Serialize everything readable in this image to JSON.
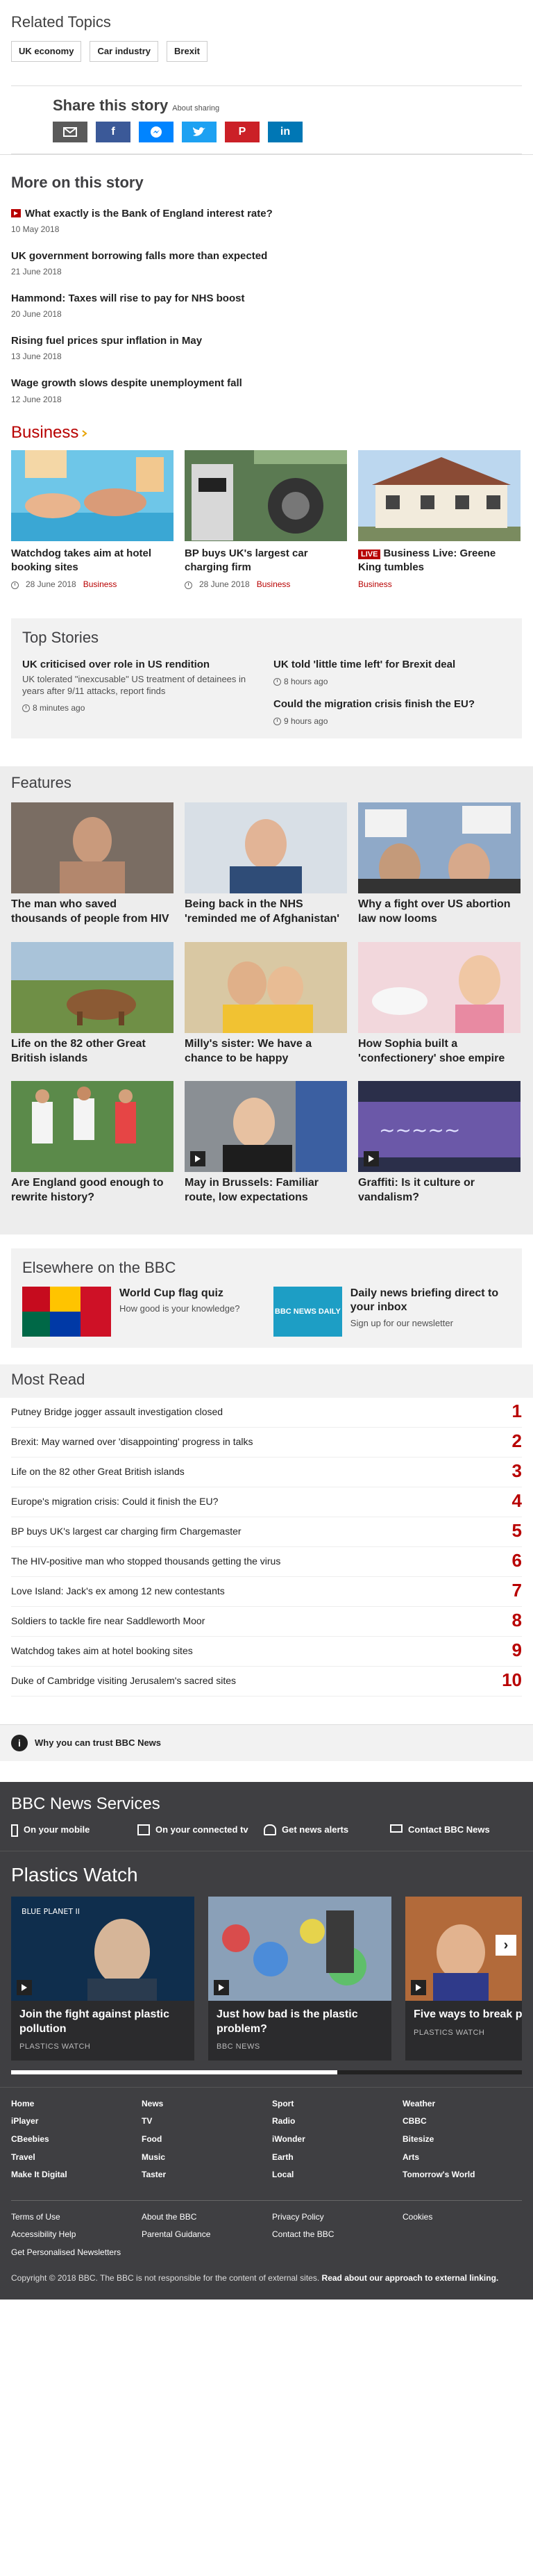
{
  "related": {
    "title": "Related Topics",
    "tags": [
      "UK economy",
      "Car industry",
      "Brexit"
    ]
  },
  "share": {
    "title": "Share this story",
    "about": "About sharing",
    "buttons": [
      "email-icon",
      "facebook-icon",
      "messenger-icon",
      "twitter-icon",
      "pinterest-icon",
      "linkedin-icon"
    ]
  },
  "more": {
    "title": "More on this story",
    "stories": [
      {
        "title": "What exactly is the Bank of England interest rate?",
        "date": "10 May 2018",
        "video": true
      },
      {
        "title": "UK government borrowing falls more than expected",
        "date": "21 June 2018"
      },
      {
        "title": "Hammond: Taxes will rise to pay for NHS boost",
        "date": "20 June 2018"
      },
      {
        "title": "Rising fuel prices spur inflation in May",
        "date": "13 June 2018"
      },
      {
        "title": "Wage growth slows despite unemployment fall",
        "date": "12 June 2018"
      }
    ]
  },
  "business": {
    "title": "Business",
    "cards": [
      {
        "title": "Watchdog takes aim at hotel booking sites",
        "date": "28 June 2018",
        "category": "Business"
      },
      {
        "title": "BP buys UK's largest car charging firm",
        "date": "28 June 2018",
        "category": "Business"
      },
      {
        "live": "LIVE",
        "title": "Business Live: Greene King tumbles",
        "category": "Business"
      }
    ]
  },
  "top_stories": {
    "title": "Top Stories",
    "items": [
      {
        "title": "UK criticised over role in US rendition",
        "summary": "UK tolerated \"inexcusable\" US treatment of detainees in years after 9/11 attacks, report finds",
        "time": "8 minutes ago"
      },
      {
        "title": "UK told 'little time left' for Brexit deal",
        "time": "8 hours ago"
      },
      {
        "title": "Could the migration crisis finish the EU?",
        "time": "9 hours ago"
      }
    ]
  },
  "features": {
    "title": "Features",
    "cards": [
      {
        "title": "The man who saved thousands of people from HIV"
      },
      {
        "title": "Being back in the NHS 'reminded me of Afghanistan'"
      },
      {
        "title": "Why a fight over US abortion law now looms"
      },
      {
        "title": "Life on the 82 other Great British islands"
      },
      {
        "title": "Milly's sister: We have a chance to be happy"
      },
      {
        "title": "How Sophia built a 'confectionery' shoe empire"
      },
      {
        "title": "Are England good enough to rewrite history?"
      },
      {
        "title": "May in Brussels: Familiar route, low expectations"
      },
      {
        "title": "Graffiti: Is it culture or vandalism?"
      }
    ]
  },
  "elsewhere": {
    "title": "Elsewhere on the BBC",
    "items": [
      {
        "title": "World Cup flag quiz",
        "sub": "How good is your knowledge?"
      },
      {
        "title": "Daily news briefing direct to your inbox",
        "sub": "Sign up for our newsletter",
        "logo": "BBC NEWS DAILY"
      }
    ]
  },
  "most_read": {
    "title": "Most Read",
    "items": [
      {
        "title": "Putney Bridge jogger assault investigation closed",
        "num": "1"
      },
      {
        "title": "Brexit: May warned over 'disappointing' progress in talks",
        "num": "2"
      },
      {
        "title": "Life on the 82 other Great British islands",
        "num": "3"
      },
      {
        "title": "Europe's migration crisis: Could it finish the EU?",
        "num": "4"
      },
      {
        "title": "BP buys UK's largest car charging firm Chargemaster",
        "num": "5"
      },
      {
        "title": "The HIV-positive man who stopped thousands getting the virus",
        "num": "6"
      },
      {
        "title": "Love Island: Jack's ex among 12 new contestants",
        "num": "7"
      },
      {
        "title": "Soldiers to tackle fire near Saddleworth Moor",
        "num": "8"
      },
      {
        "title": "Watchdog takes aim at hotel booking sites",
        "num": "9"
      },
      {
        "title": "Duke of Cambridge visiting Jerusalem's sacred sites",
        "num": "10"
      }
    ]
  },
  "trust": {
    "label": "Why you can trust BBC News",
    "icon": "i"
  },
  "services": {
    "title": "BBC News Services",
    "items": [
      "On your mobile",
      "On your connected tv",
      "Get news alerts",
      "Contact BBC News"
    ]
  },
  "plastics": {
    "title": "Plastics Watch",
    "cards": [
      {
        "title": "Join the fight against plastic pollution",
        "source": "PLASTICS WATCH"
      },
      {
        "title": "Just how bad is the plastic problem?",
        "source": "BBC NEWS"
      },
      {
        "title": "Five ways to break plastic",
        "source": "PLASTICS WATCH"
      }
    ],
    "next": "›",
    "overlay": "BLUE PLANET II"
  },
  "footer": {
    "cols": [
      [
        "Home",
        "iPlayer",
        "CBeebies",
        "Travel",
        "Make It Digital"
      ],
      [
        "News",
        "TV",
        "Food",
        "Music",
        "Taster"
      ],
      [
        "Sport",
        "Radio",
        "iWonder",
        "Earth",
        "Local"
      ],
      [
        "Weather",
        "CBBC",
        "Bitesize",
        "Arts",
        "Tomorrow's World"
      ]
    ],
    "links": [
      [
        "Terms of Use",
        "Accessibility Help",
        "Get Personalised Newsletters"
      ],
      [
        "About the BBC",
        "Parental Guidance"
      ],
      [
        "Privacy Policy",
        "Contact the BBC"
      ],
      [
        "Cookies"
      ]
    ],
    "copyright": "Copyright © 2018 BBC. The BBC is not responsible for the content of external sites.",
    "external": "Read about our approach to external linking."
  },
  "colors": {
    "accent": "#b80000",
    "dark": "#3f3f42",
    "light": "#f2f2f2"
  }
}
